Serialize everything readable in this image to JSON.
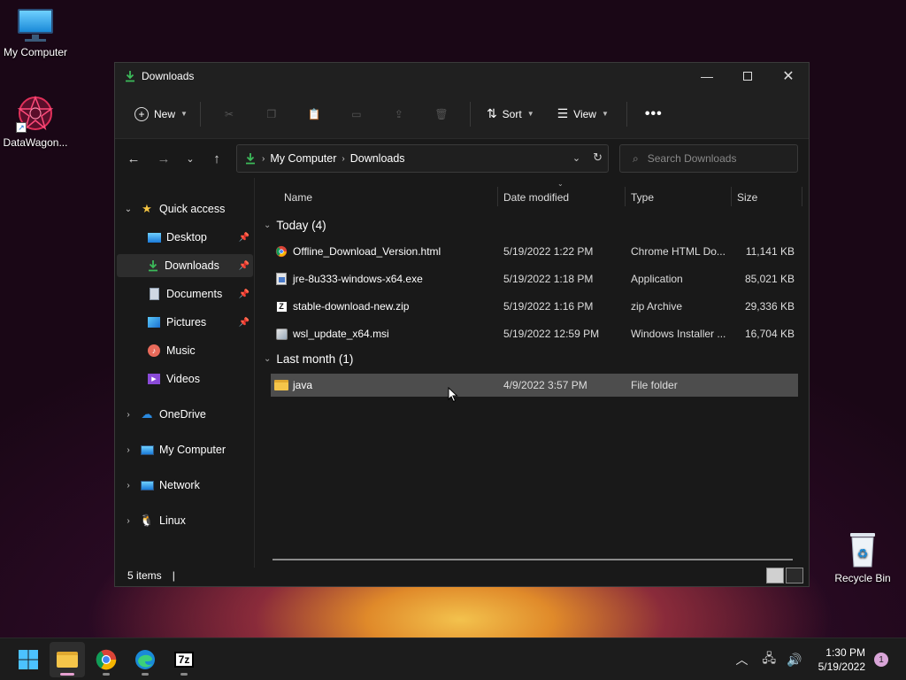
{
  "desktop": {
    "icons": [
      {
        "label": "My Computer",
        "icon": "monitor-icon"
      },
      {
        "label": "DataWagon...",
        "icon": "datawagon-icon"
      },
      {
        "label": "Recycle Bin",
        "icon": "recycle-bin-icon"
      }
    ]
  },
  "window": {
    "title": "Downloads",
    "toolbar": {
      "new_label": "New",
      "sort_label": "Sort",
      "view_label": "View"
    },
    "address": {
      "segments": [
        "My Computer",
        "Downloads"
      ]
    },
    "search": {
      "placeholder": "Search Downloads"
    },
    "sidebar": {
      "quick_access": "Quick access",
      "items": [
        {
          "label": "Desktop",
          "pinned": true
        },
        {
          "label": "Downloads",
          "pinned": true,
          "selected": true
        },
        {
          "label": "Documents",
          "pinned": true
        },
        {
          "label": "Pictures",
          "pinned": true
        },
        {
          "label": "Music",
          "pinned": false
        },
        {
          "label": "Videos",
          "pinned": false
        }
      ],
      "roots": [
        "OneDrive",
        "My Computer",
        "Network",
        "Linux"
      ]
    },
    "columns": {
      "name": "Name",
      "date": "Date modified",
      "type": "Type",
      "size": "Size"
    },
    "groups": [
      {
        "title": "Today (4)",
        "files": [
          {
            "name": "Offline_Download_Version.html",
            "date": "5/19/2022 1:22 PM",
            "type": "Chrome HTML Do...",
            "size": "11,141 KB",
            "icon": "chrome-html-icon"
          },
          {
            "name": "jre-8u333-windows-x64.exe",
            "date": "5/19/2022 1:18 PM",
            "type": "Application",
            "size": "85,021 KB",
            "icon": "exe-icon"
          },
          {
            "name": "stable-download-new.zip",
            "date": "5/19/2022 1:16 PM",
            "type": "zip Archive",
            "size": "29,336 KB",
            "icon": "zip-icon"
          },
          {
            "name": "wsl_update_x64.msi",
            "date": "5/19/2022 12:59 PM",
            "type": "Windows Installer ...",
            "size": "16,704 KB",
            "icon": "msi-icon"
          }
        ]
      },
      {
        "title": "Last month (1)",
        "files": [
          {
            "name": "java",
            "date": "4/9/2022 3:57 PM",
            "type": "File folder",
            "size": "",
            "icon": "folder-icon"
          }
        ]
      }
    ],
    "status": {
      "items": "5 items"
    }
  },
  "taskbar": {
    "time": "1:30 PM",
    "date": "5/19/2022",
    "notifications": "1"
  },
  "colors": {
    "accent": "#3cbb5a",
    "folder": "#f5c54a"
  }
}
